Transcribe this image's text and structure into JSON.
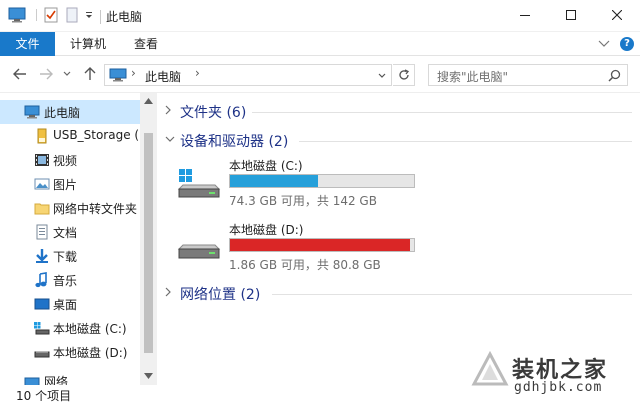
{
  "window": {
    "title": "此电脑"
  },
  "ribbon": {
    "tabs": [
      "文件",
      "计算机",
      "查看"
    ]
  },
  "address": {
    "path": "此电脑",
    "separator": "›"
  },
  "search": {
    "placeholder": "搜索\"此电脑\""
  },
  "nav": {
    "items": [
      {
        "label": "此电脑",
        "icon": "computer-icon",
        "selected": true
      },
      {
        "label": "USB_Storage (F",
        "icon": "usb-drive-icon"
      },
      {
        "label": "视频",
        "icon": "video-folder-icon"
      },
      {
        "label": "图片",
        "icon": "pictures-folder-icon"
      },
      {
        "label": "网络中转文件夹",
        "icon": "folder-icon"
      },
      {
        "label": "文档",
        "icon": "documents-folder-icon"
      },
      {
        "label": "下载",
        "icon": "downloads-folder-icon"
      },
      {
        "label": "音乐",
        "icon": "music-folder-icon"
      },
      {
        "label": "桌面",
        "icon": "desktop-folder-icon"
      },
      {
        "label": "本地磁盘 (C:)",
        "icon": "drive-c-icon"
      },
      {
        "label": "本地磁盘 (D:)",
        "icon": "drive-d-icon"
      },
      {
        "label": "网络",
        "icon": "network-icon"
      }
    ]
  },
  "content": {
    "groups": [
      {
        "title": "文件夹 (6)",
        "expanded": false
      },
      {
        "title": "设备和驱动器 (2)",
        "expanded": true
      },
      {
        "title": "网络位置 (2)",
        "expanded": false
      }
    ],
    "drives": [
      {
        "name": "本地磁盘 (C:)",
        "free": "74.3 GB 可用，共 142 GB",
        "used_fraction": 0.477,
        "bar_color": "#26a0da"
      },
      {
        "name": "本地磁盘 (D:)",
        "free": "1.86 GB 可用，共 80.8 GB",
        "used_fraction": 0.977,
        "bar_color": "#da2626"
      }
    ]
  },
  "status": {
    "item_count": "10 个项目"
  },
  "watermark": {
    "title": "装机之家",
    "url": "gdhjbk.com"
  },
  "colors": {
    "accent": "#1979ca",
    "selection": "#cce8ff",
    "group_title": "#1e3287"
  }
}
